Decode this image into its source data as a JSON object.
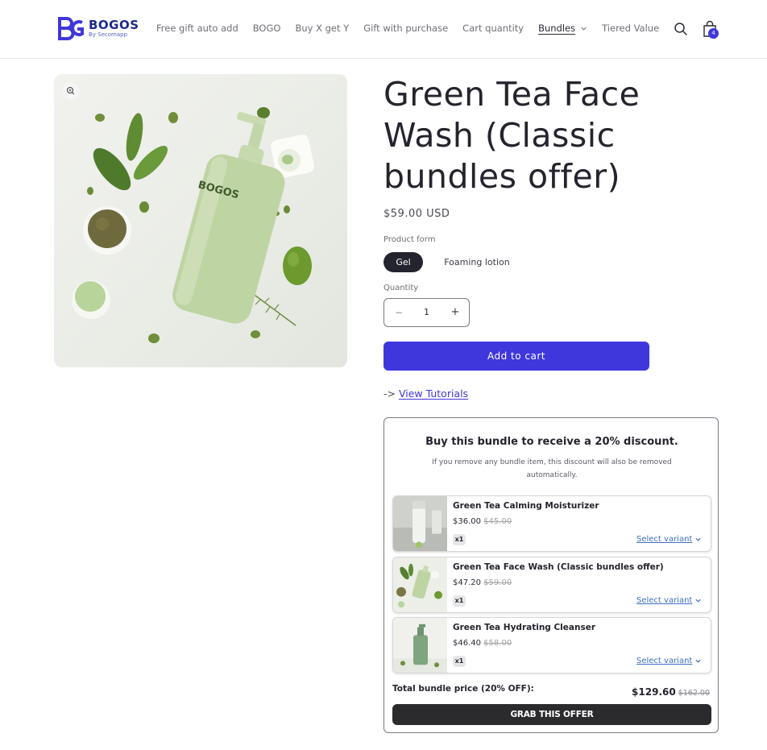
{
  "brand": {
    "name": "BOGOS",
    "tagline": "By Secomapp"
  },
  "nav": [
    {
      "label": "Free gift auto add"
    },
    {
      "label": "BOGO"
    },
    {
      "label": "Buy X get Y"
    },
    {
      "label": "Gift with purchase"
    },
    {
      "label": "Cart quantity"
    },
    {
      "label": "Bundles",
      "active": true,
      "has_dropdown": true
    },
    {
      "label": "Tiered Value"
    }
  ],
  "cart": {
    "count": "4"
  },
  "product": {
    "title": "Green Tea Face Wash (Classic bundles offer)",
    "price": "$59.00 USD",
    "image_label": "BOGOS",
    "form_label": "Product form",
    "variants": [
      "Gel",
      "Foaming lotion"
    ],
    "selected_variant": "Gel",
    "quantity_label": "Quantity",
    "quantity": "1",
    "qty_minus": "−",
    "qty_plus": "+",
    "add_to_cart": "Add to cart",
    "tutorial_prefix": "-> ",
    "tutorial_link": "View Tutorials"
  },
  "bundle": {
    "heading": "Buy this bundle to receive a 20% discount.",
    "note": "If you remove any bundle item, this discount will also be removed automatically.",
    "items": [
      {
        "name": "Green Tea Calming Moisturizer",
        "price": "$36.00",
        "old_price": "$45.00",
        "qty": "x1",
        "variant_link": "Select variant"
      },
      {
        "name": "Green Tea Face Wash (Classic bundles offer)",
        "price": "$47.20",
        "old_price": "$59.00",
        "qty": "x1",
        "variant_link": "Select variant"
      },
      {
        "name": "Green Tea Hydrating Cleanser",
        "price": "$46.40",
        "old_price": "$58.00",
        "qty": "x1",
        "variant_link": "Select variant"
      }
    ],
    "total_label": "Total bundle price (20% OFF):",
    "total_price": "$129.60",
    "total_old_price": "$162.00",
    "cta": "GRAB THIS OFFER"
  },
  "colors": {
    "accent": "#3f37dc",
    "dark": "#24242e",
    "link": "#3f6fc0"
  },
  "icons": [
    "search-icon",
    "cart-icon",
    "zoom-icon",
    "chevron-down-icon"
  ]
}
